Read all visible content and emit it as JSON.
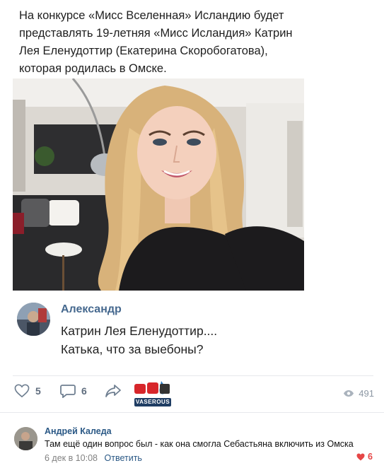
{
  "post": {
    "text_lines": [
      "На конкурсе «Мисс Вселенная» Исландию будет",
      "представлять 19-летняя «Мисс Исландия» Катрин",
      "Лея Еленудоттир (Екатерина Скоробогатова),",
      "которая родилась в Омске."
    ]
  },
  "comment": {
    "author": "Александр",
    "lines": [
      "Катрин Лея Еленудоттир....",
      "Катька, что за выебоны?"
    ]
  },
  "actions": {
    "likes": "5",
    "comments": "6",
    "views": "491",
    "logo_text": "VASEROUS"
  },
  "reply": {
    "author": "Андрей Каледа",
    "text": "Там ещё один вопрос был - как она смогла Себастьяна включить из Омска",
    "date": "6 дек в 10:08",
    "reply_label": "Ответить",
    "likes": "6"
  },
  "colors": {
    "link": "#2a5885",
    "author_blue": "#45688e",
    "like_red": "#e64646",
    "icon_gray": "#5f6d7e"
  }
}
